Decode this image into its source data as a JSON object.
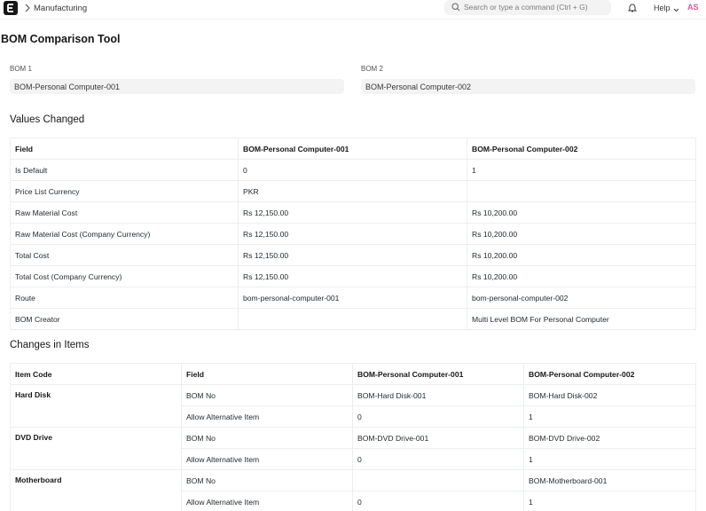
{
  "navbar": {
    "breadcrumb": "Manufacturing",
    "search_placeholder": "Search or type a command (Ctrl + G)",
    "help_label": "Help",
    "avatar_initials": "AS"
  },
  "page": {
    "title": "BOM Comparison Tool"
  },
  "fields": {
    "bom1_label": "BOM 1",
    "bom1_value": "BOM-Personal Computer-001",
    "bom2_label": "BOM 2",
    "bom2_value": "BOM-Personal Computer-002"
  },
  "values_changed": {
    "heading": "Values Changed",
    "headers": [
      "Field",
      "BOM-Personal Computer-001",
      "BOM-Personal Computer-002"
    ],
    "rows": [
      [
        "Is Default",
        "0",
        "1"
      ],
      [
        "Price List Currency",
        "PKR",
        ""
      ],
      [
        "Raw Material Cost",
        "Rs 12,150.00",
        "Rs 10,200.00"
      ],
      [
        "Raw Material Cost (Company Currency)",
        "Rs 12,150.00",
        "Rs 10,200.00"
      ],
      [
        "Total Cost",
        "Rs 12,150.00",
        "Rs 10,200.00"
      ],
      [
        "Total Cost (Company Currency)",
        "Rs 12,150.00",
        "Rs 10,200.00"
      ],
      [
        "Route",
        "bom-personal-computer-001",
        "bom-personal-computer-002"
      ],
      [
        "BOM Creator",
        "",
        "Multi Level BOM For Personal Computer"
      ]
    ]
  },
  "changes_in_items": {
    "heading": "Changes in Items",
    "headers": [
      "Item Code",
      "Field",
      "BOM-Personal Computer-001",
      "BOM-Personal Computer-002"
    ],
    "items": [
      {
        "code": "Hard Disk",
        "rows": [
          [
            "BOM No",
            "BOM-Hard Disk-001",
            "BOM-Hard Disk-002"
          ],
          [
            "Allow Alternative Item",
            "0",
            "1"
          ]
        ]
      },
      {
        "code": "DVD Drive",
        "rows": [
          [
            "BOM No",
            "BOM-DVD Drive-001",
            "BOM-DVD Drive-002"
          ],
          [
            "Allow Alternative Item",
            "0",
            "1"
          ]
        ]
      },
      {
        "code": "Motherboard",
        "rows": [
          [
            "BOM No",
            "",
            "BOM-Motherboard-001"
          ],
          [
            "Allow Alternative Item",
            "0",
            "1"
          ]
        ]
      }
    ]
  },
  "colors": {
    "avatar": "#e05a9a",
    "input_bg": "#f3f3f3",
    "border": "#ebeef0"
  }
}
